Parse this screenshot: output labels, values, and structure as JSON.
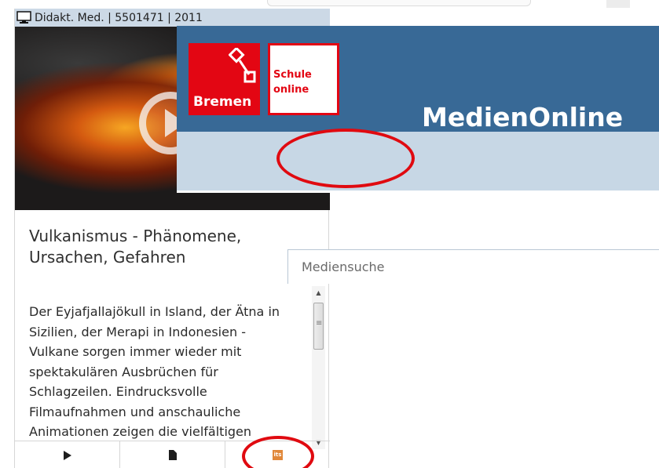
{
  "card": {
    "header": "Didakt. Med. | 5501471 | 2011",
    "header_icon": "monitor-icon",
    "title": "Vulkanismus - Phänomene, Ursachen, Gefahren",
    "description": "Der Eyjafjallajökull in Island, der Ätna in Sizilien, der Merapi in Indonesien - Vulkane sorgen immer wieder mit spektakulären Ausbrüchen für Schlagzeilen. Eindrucksvolle Filmaufnahmen und anschauliche Animationen zeigen die vielfältigen",
    "toolbar": [
      {
        "icon": "play-icon"
      },
      {
        "icon": "document-icon"
      },
      {
        "icon": "its-icon",
        "label": "its"
      }
    ]
  },
  "banner": {
    "logo_left_text": "Bremen",
    "logo_right_text_line1": "Schule",
    "logo_right_text_line2": "online",
    "title": "MedienOnline",
    "search_placeholder": "Mediensuche"
  },
  "colors": {
    "banner_blue": "#386996",
    "search_band": "#c7d7e5",
    "logo_red": "#e30613",
    "annotation_red": "#e00a10",
    "header_blue": "#ccd9e6"
  }
}
